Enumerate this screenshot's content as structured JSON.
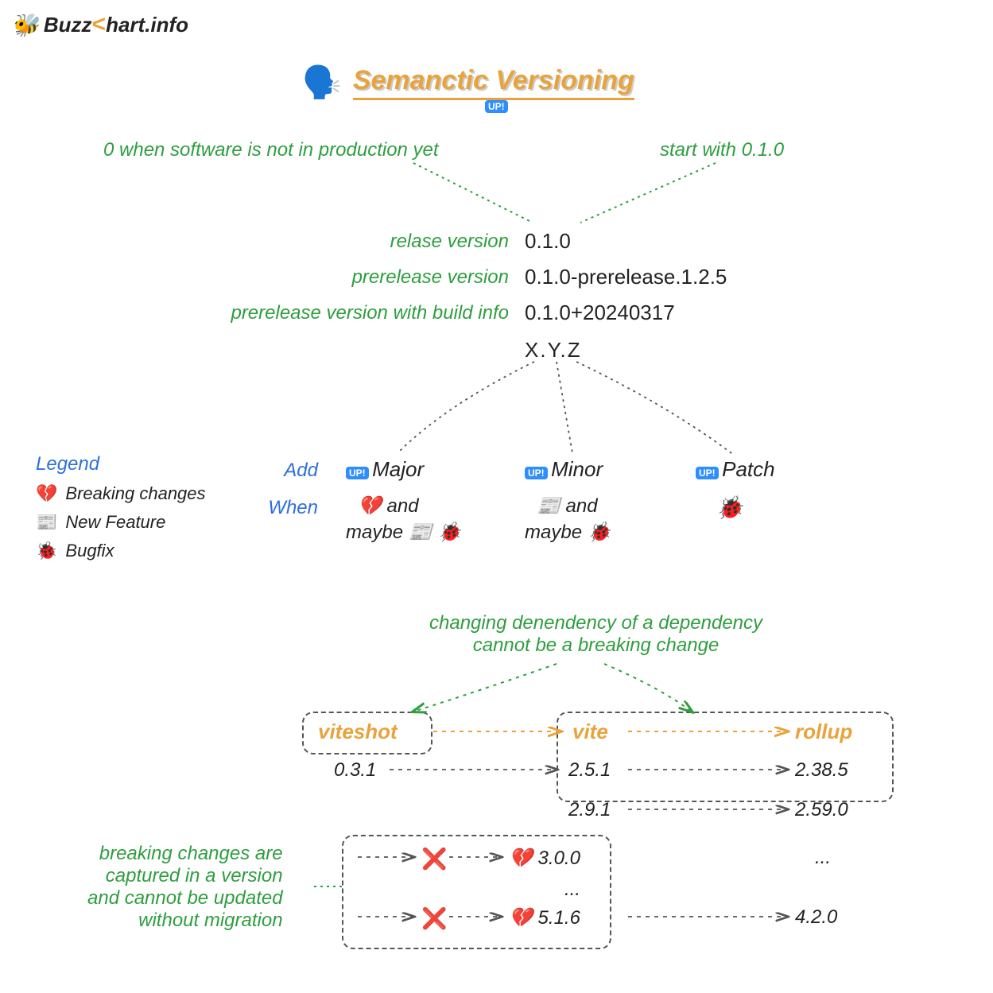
{
  "brand": {
    "name_part1": "Buzz",
    "name_part2": "hart.info"
  },
  "title": "Semanctic Versioning",
  "badges": {
    "up": "UP!"
  },
  "notes": {
    "zero_not_prod": "0 when software is not in production yet",
    "start_with": "start with 0.1.0",
    "dep_of_dep": "changing denendency of a dependency\ncannot be a breaking change",
    "breaking_captured": "breaking changes are\ncaptured in a version\nand cannot be updated\nwithout migration"
  },
  "version_examples": {
    "release": {
      "label": "relase version",
      "value": "0.1.0"
    },
    "prerelease": {
      "label": "prerelease version",
      "value": "0.1.0-prerelease.1.2.5"
    },
    "buildinfo": {
      "label": "prerelease version with build info",
      "value": "0.1.0+20240317"
    },
    "pattern": "X.Y.Z"
  },
  "parts": {
    "add_label": "Add",
    "when_label": "When",
    "major": {
      "name": "Major",
      "when_line1": "💔 and",
      "when_line2": "maybe 📰 🐞"
    },
    "minor": {
      "name": "Minor",
      "when_line1": "📰 and",
      "when_line2": "maybe 🐞"
    },
    "patch": {
      "name": "Patch",
      "when_line1": "🐞"
    }
  },
  "legend": {
    "title": "Legend",
    "items": [
      {
        "icon": "💔",
        "label": "Breaking changes"
      },
      {
        "icon": "📰",
        "label": "New Feature"
      },
      {
        "icon": "🐞",
        "label": "Bugfix"
      }
    ]
  },
  "deps": {
    "cols": [
      "viteshot",
      "vite",
      "rollup"
    ],
    "rows": [
      [
        "0.3.1",
        "2.5.1",
        "2.38.5"
      ],
      [
        "",
        "2.9.1",
        "2.59.0"
      ],
      [
        "❌",
        "💔 3.0.0",
        "..."
      ],
      [
        "",
        "...",
        ""
      ],
      [
        "❌",
        "💔 5.1.6",
        "4.2.0"
      ]
    ]
  }
}
